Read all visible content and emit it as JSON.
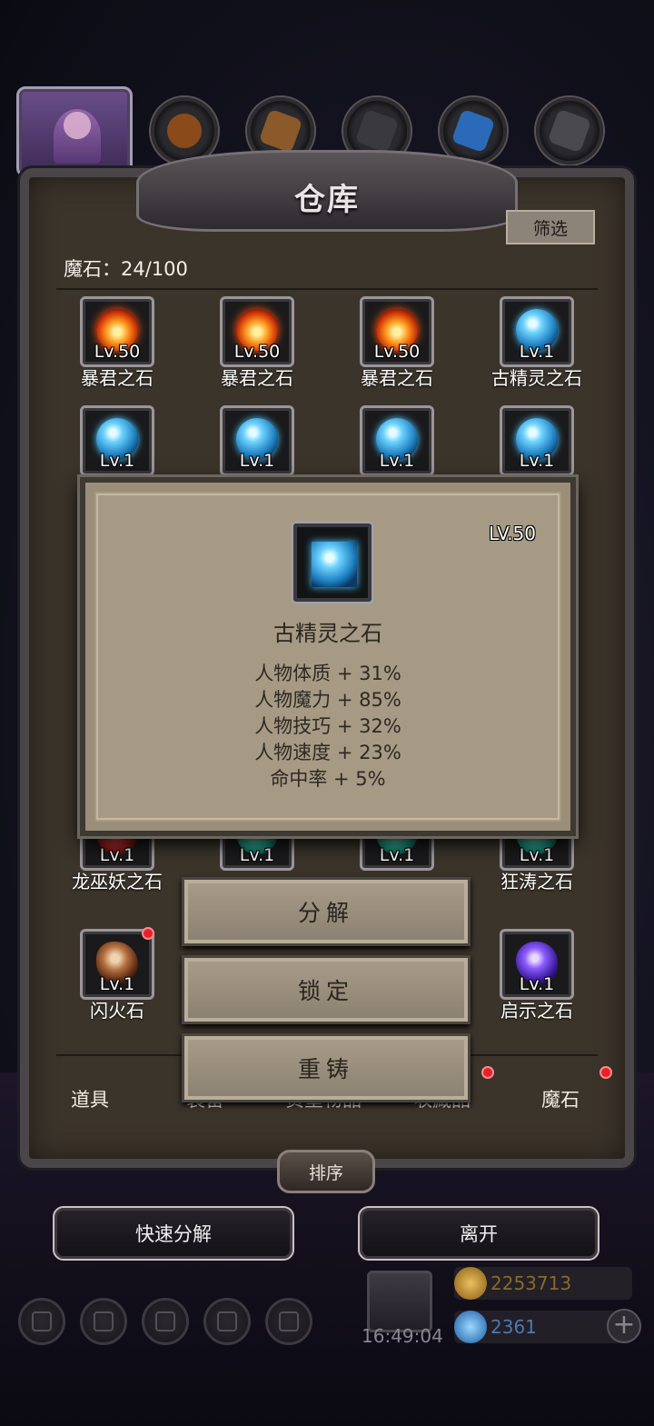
{
  "title": "仓库",
  "filter_label": "筛选",
  "count_label": "魔石：24/100",
  "colors": {
    "panel": "#3b342b",
    "popup": "#a69a85",
    "accent_red": "#e8202a"
  },
  "top_categories": [
    {
      "icon": "potion-icon"
    },
    {
      "icon": "wood-icon"
    },
    {
      "icon": "ore-icon"
    },
    {
      "icon": "crystal-icon"
    },
    {
      "icon": "metal-icon"
    }
  ],
  "items": [
    {
      "level": "Lv.50",
      "name": "暴君之石",
      "kind": "fire"
    },
    {
      "level": "Lv.50",
      "name": "暴君之石",
      "kind": "fire"
    },
    {
      "level": "Lv.50",
      "name": "暴君之石",
      "kind": "fire"
    },
    {
      "level": "Lv.1",
      "name": "古精灵之石",
      "kind": "blue"
    },
    {
      "level": "Lv.1",
      "name": "",
      "kind": "blue"
    },
    {
      "level": "Lv.1",
      "name": "",
      "kind": "blue"
    },
    {
      "level": "Lv.1",
      "name": "",
      "kind": "blue"
    },
    {
      "level": "Lv.1",
      "name": "",
      "kind": "blue"
    },
    {
      "level": "Lv.1",
      "name": "龙巫妖之石",
      "kind": "dragon"
    },
    {
      "level": "Lv.1",
      "name": "",
      "kind": "green"
    },
    {
      "level": "Lv.1",
      "name": "",
      "kind": "green"
    },
    {
      "level": "Lv.1",
      "name": "狂涛之石",
      "kind": "green"
    },
    {
      "level": "Lv.1",
      "name": "闪火石",
      "kind": "rock"
    },
    {
      "level": "Lv.1",
      "name": "启示之石",
      "kind": "purple"
    }
  ],
  "popup": {
    "level": "LV.50",
    "name": "古精灵之石",
    "stats": [
      "人物体质 + 31%",
      "人物魔力 + 85%",
      "人物技巧 + 32%",
      "人物速度 + 23%",
      "命中率 + 5%"
    ]
  },
  "actions": {
    "decompose": "分解",
    "lock": "锁定",
    "reforge": "重铸"
  },
  "bottom_tabs": [
    "道具",
    "装备",
    "贵重物品",
    "收藏品",
    "魔石"
  ],
  "sort_label": "排序",
  "quick_decompose_label": "快速分解",
  "leave_label": "离开",
  "clock": "16:49:04",
  "gold": "2253713",
  "diamonds": "2361"
}
